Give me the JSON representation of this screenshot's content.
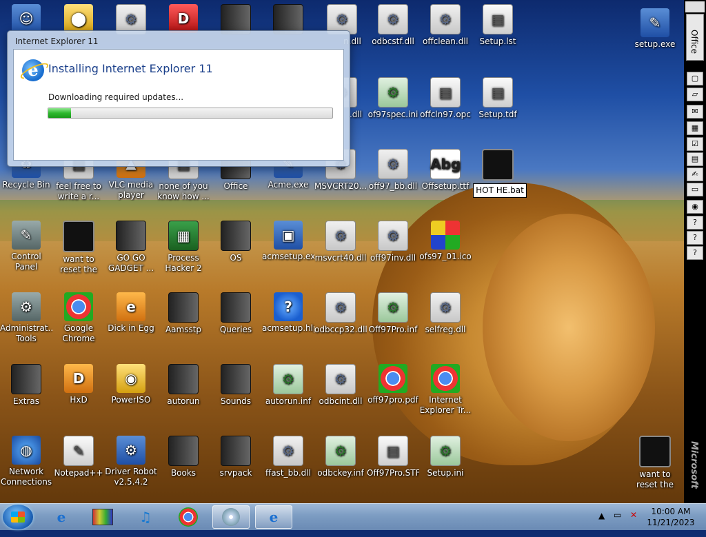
{
  "desktop": {
    "icons": [
      {
        "id": "odbcstf",
        "label": "odbcstf.dll"
      },
      {
        "id": "offclean",
        "label": "offclean.dll"
      },
      {
        "id": "setup_lst",
        "label": "Setup.lst"
      },
      {
        "id": "setup_exe",
        "label": "setup.exe"
      },
      {
        "id": "of97spec",
        "label": "of97spec.ini"
      },
      {
        "id": "offcln97",
        "label": "offcln97.opc"
      },
      {
        "id": "setup_tdf",
        "label": "Setup.tdf"
      },
      {
        "id": "recycle_bin",
        "label": "Recycle Bin"
      },
      {
        "id": "feel_free",
        "label": "feel free to write a r..."
      },
      {
        "id": "vlc",
        "label": "VLC media player"
      },
      {
        "id": "none_of_you",
        "label": "none of you know how ..."
      },
      {
        "id": "office",
        "label": "Office"
      },
      {
        "id": "acme",
        "label": "Acme.exe"
      },
      {
        "id": "msvcrt20",
        "label": "MSVCRT20...."
      },
      {
        "id": "off97_bb",
        "label": "off97_bb.dll"
      },
      {
        "id": "offsetup_ttf",
        "label": "Offsetup.ttf"
      },
      {
        "id": "control_panel",
        "label": "Control Panel"
      },
      {
        "id": "want_reset_1",
        "label": "want to reset the vm lau..."
      },
      {
        "id": "gogo",
        "label": "GO GO GADGET ..."
      },
      {
        "id": "process_hacker",
        "label": "Process Hacker 2"
      },
      {
        "id": "os",
        "label": "OS"
      },
      {
        "id": "acmsetup_exe",
        "label": "acmsetup.exe"
      },
      {
        "id": "msvcrt40",
        "label": "msvcrt40.dll"
      },
      {
        "id": "off97inv",
        "label": "off97inv.dll"
      },
      {
        "id": "ofs97_01",
        "label": "ofs97_01.ico"
      },
      {
        "id": "admin_tools",
        "label": "Administrat... Tools"
      },
      {
        "id": "chrome",
        "label": "Google Chrome"
      },
      {
        "id": "dick_in_egg",
        "label": "Dick in Egg"
      },
      {
        "id": "aamsstp",
        "label": "Aamsstp"
      },
      {
        "id": "queries",
        "label": "Queries"
      },
      {
        "id": "acmsetup_hlp",
        "label": "acmsetup.hlp"
      },
      {
        "id": "odbccp32",
        "label": "odbccp32.dll"
      },
      {
        "id": "off97pro_inf",
        "label": "Off97Pro.inf"
      },
      {
        "id": "selfreg",
        "label": "selfreg.dll"
      },
      {
        "id": "extras",
        "label": "Extras"
      },
      {
        "id": "hxd",
        "label": "HxD"
      },
      {
        "id": "poweriso",
        "label": "PowerISO"
      },
      {
        "id": "autorun",
        "label": "autorun"
      },
      {
        "id": "sounds",
        "label": "Sounds"
      },
      {
        "id": "autorun_inf",
        "label": "autorun.inf"
      },
      {
        "id": "odbcint",
        "label": "odbcint.dll"
      },
      {
        "id": "off97pro_pdf",
        "label": "off97pro.pdf"
      },
      {
        "id": "ie_tr",
        "label": "Internet Explorer Tr..."
      },
      {
        "id": "network",
        "label": "Network Connections"
      },
      {
        "id": "notepadpp",
        "label": "Notepad++"
      },
      {
        "id": "driver_robot",
        "label": "Driver Robot v2.5.4.2"
      },
      {
        "id": "books",
        "label": "Books"
      },
      {
        "id": "srvpack",
        "label": "srvpack"
      },
      {
        "id": "ffast_bb",
        "label": "ffast_bb.dll"
      },
      {
        "id": "odbckey",
        "label": "odbckey.inf"
      },
      {
        "id": "off97pro_stf",
        "label": "Off97Pro.STF"
      },
      {
        "id": "setup_ini",
        "label": "Setup.ini"
      },
      {
        "id": "want_reset_2",
        "label": "want to reset the vm lau..."
      },
      {
        "id": "partial_dll_1",
        "label": "n.dll"
      },
      {
        "id": "partial_dll_2",
        "label": ".dll"
      }
    ],
    "rename_value": "HOT HE.bat"
  },
  "dialog": {
    "window_title": "Internet Explorer 11",
    "heading": "Installing Internet Explorer 11",
    "status": "Downloading required updates...",
    "progress_percent": 8
  },
  "officebar": {
    "label": "Office",
    "brand": "Microsoft"
  },
  "taskbar": {
    "time": "10:00 AM",
    "date": "11/21/2023"
  }
}
